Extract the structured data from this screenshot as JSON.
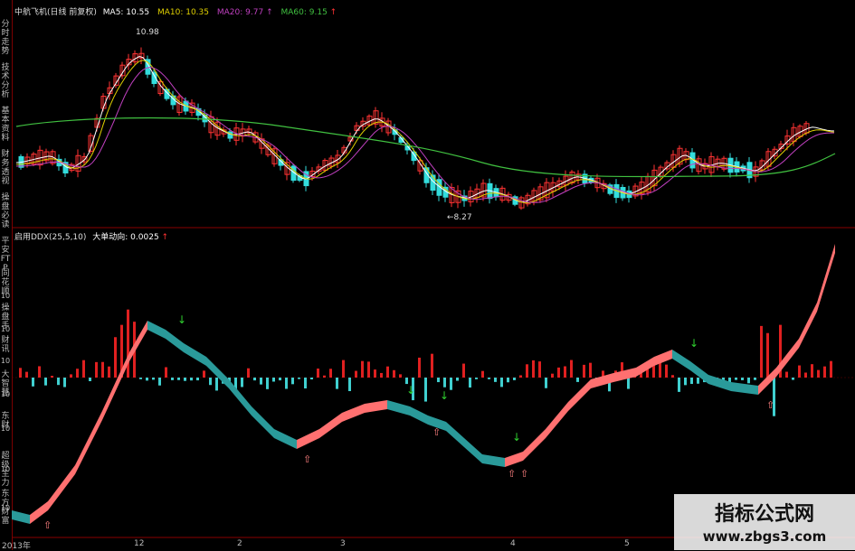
{
  "sidebar": {
    "items": [
      "分时走势",
      "技术分析",
      "基本资料",
      "财务透视",
      "操盘必读",
      "平安FTP",
      "同花顺",
      "操盘手",
      "财讯",
      "大智慧",
      "东财",
      "超级主力",
      "东方财富"
    ],
    "tick_labels": [
      "10",
      "10",
      "10",
      "10",
      "10",
      "10",
      "10"
    ]
  },
  "price_header": {
    "stock": "中航飞机(日线 前复权)",
    "ma5": "MA5: 10.55",
    "ma10": "MA10: 10.35",
    "ma20": "MA20: 9.77",
    "ma60": "MA60: 9.15",
    "arrow": "↑"
  },
  "annotations": {
    "high": "10.98",
    "low": "←8.27"
  },
  "indicator_header": {
    "name": "启用DDX(25,5,10)",
    "value": "大单动向: 0.0025",
    "arrow": "↑"
  },
  "dates": [
    "2013年",
    "12",
    "2",
    "3",
    "4",
    "5"
  ],
  "watermark": {
    "title": "指标公式网",
    "url": "www.zbgs3.com"
  },
  "colors": {
    "up": "#ff3333",
    "down": "#33dddd",
    "ma5": "#ffffff",
    "ma10": "#e0d000",
    "ma20": "#c040c0",
    "ma60": "#40c040",
    "ribbon_up": "#ff7070",
    "ribbon_down": "#2a9a9a",
    "bar_pos": "#e02020",
    "bar_neg": "#40d0d0"
  }
}
